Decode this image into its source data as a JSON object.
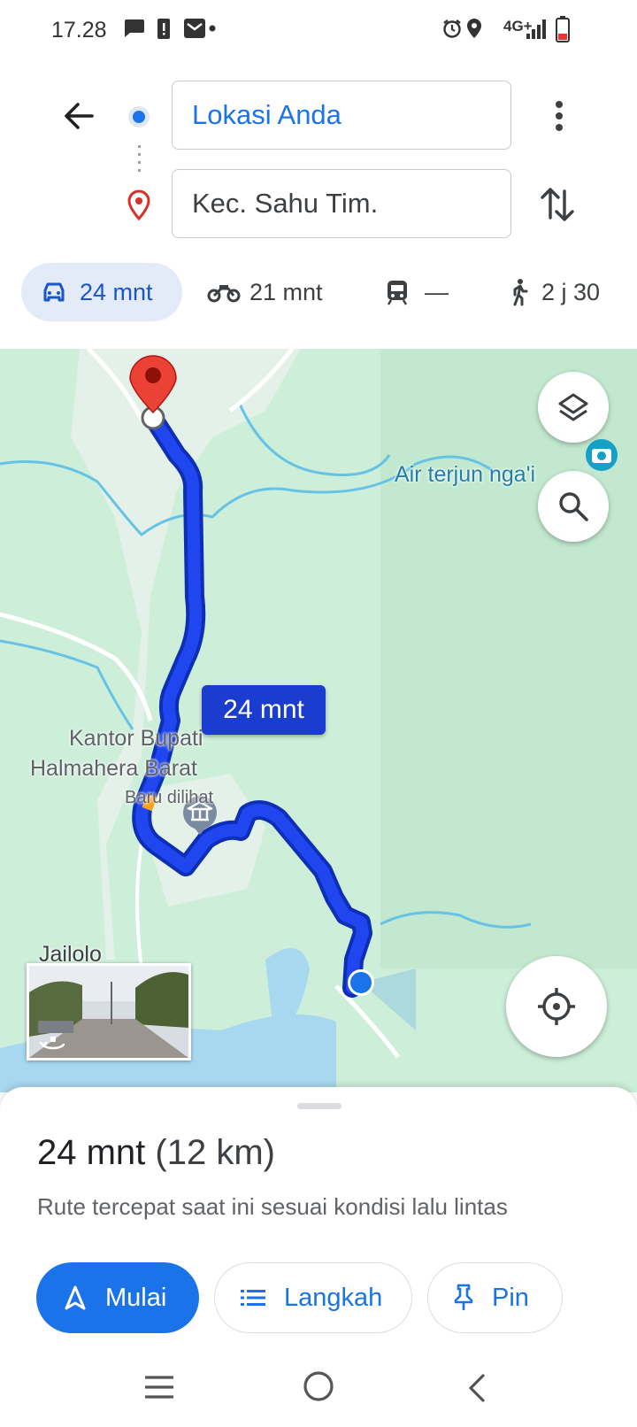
{
  "status_bar": {
    "time": "17.28",
    "network": "4G+"
  },
  "directions": {
    "origin_value": "Lokasi Anda",
    "destination_value": "Kec. Sahu Tim."
  },
  "modes": [
    {
      "name": "car",
      "label": "24 mnt",
      "selected": true
    },
    {
      "name": "motorcycle",
      "label": "21 mnt"
    },
    {
      "name": "transit",
      "label": "—"
    },
    {
      "name": "walk",
      "label": "2 j 30"
    }
  ],
  "map": {
    "route_time_chip": "24 mnt",
    "labels": {
      "waterfall": "Air terjun nga'i",
      "kantor_line1": "Kantor Bupati",
      "kantor_line2": "Halmahera Barat",
      "recently_viewed": "Baru dilihat",
      "town": "Jailolo"
    },
    "route_color": "#1a3ccf",
    "accent": "#1a73e8"
  },
  "sheet": {
    "duration": "24 mnt",
    "distance": "(12 km)",
    "description": "Rute tercepat saat ini sesuai kondisi lalu lintas",
    "start_label": "Mulai",
    "steps_label": "Langkah",
    "pin_label": "Pin"
  }
}
